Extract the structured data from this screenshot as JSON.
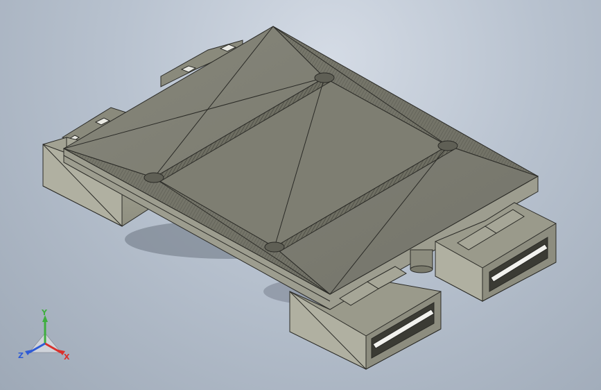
{
  "viewport": {
    "background_top": "#d4dbe5",
    "background_bottom": "#9ea9b7"
  },
  "model": {
    "face_color": "#7b7b6d",
    "edge_color": "#2a2a26",
    "shadow_color": "#6f7785"
  },
  "triad": {
    "x_label": "X",
    "y_label": "Y",
    "z_label": "Z",
    "x_color": "#d9302b",
    "y_color": "#3fae3f",
    "z_color": "#2e5bd6"
  }
}
